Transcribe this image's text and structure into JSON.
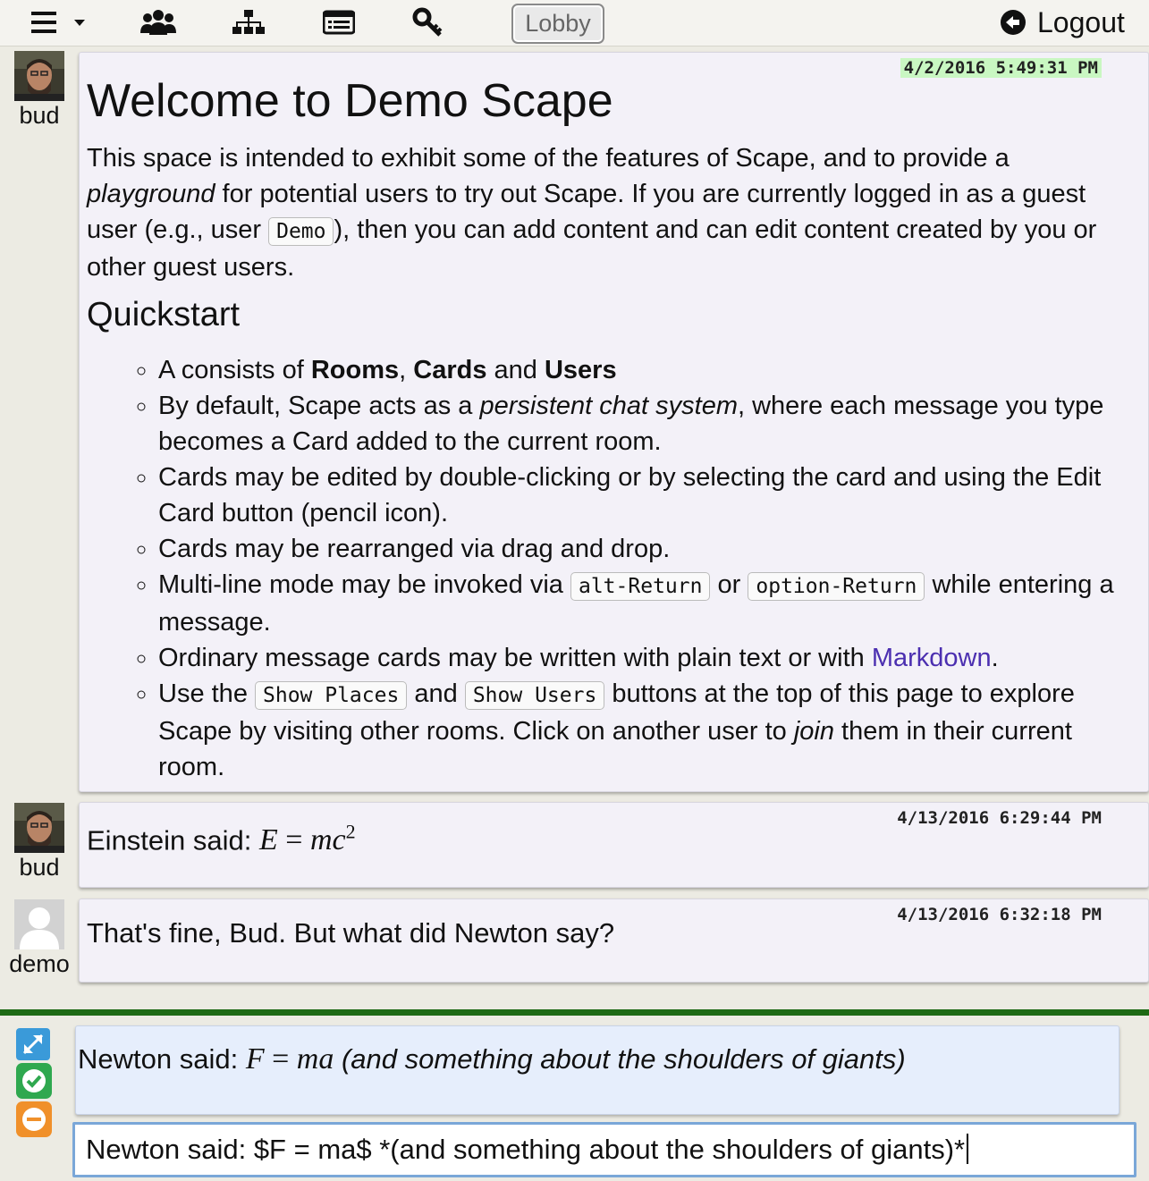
{
  "nav": {
    "lobby_label": "Lobby",
    "logout_label": "Logout",
    "icons": [
      "menu-icon",
      "users-icon",
      "places-icon",
      "cards-list-icon",
      "key-icon",
      "logout-icon"
    ]
  },
  "cards": [
    {
      "user": "bud",
      "timestamp": "4/2/2016 5:49:31 PM",
      "title": "Welcome to Demo Scape",
      "intro": {
        "p1": "This space is intended to exhibit some of the features of Scape, and to provide a ",
        "em": "playground",
        "p2": " for potential users to try out Scape. If you are currently logged in as a guest user (e.g., user ",
        "code": "Demo",
        "p3": "), then you can add content and can edit content created by you or other guest users."
      },
      "subtitle": "Quickstart",
      "items": {
        "i1": {
          "a": "A consists of ",
          "b1": "Rooms",
          "c": ", ",
          "b2": "Cards",
          "d": " and ",
          "b3": "Users"
        },
        "i2": {
          "a": "By default, Scape acts as a ",
          "em": "persistent chat system",
          "b": ", where each message you type becomes a Card added to the current room."
        },
        "i3": "Cards may be edited by double-clicking or by selecting the card and using the Edit Card button (pencil icon).",
        "i4": "Cards may be rearranged via drag and drop.",
        "i5": {
          "a": "Multi-line mode may be invoked via ",
          "k1": "alt-Return",
          "b": " or ",
          "k2": "option-Return",
          "c": " while entering a message."
        },
        "i6": {
          "a": "Ordinary message cards may be written with plain text or with ",
          "link": "Markdown",
          "b": "."
        },
        "i7": {
          "a": "Use the ",
          "k1": "Show Places",
          "b": " and ",
          "k2": "Show Users",
          "c": " buttons at the top of this page to explore Scape by visiting other rooms. Click on another user to ",
          "em": "join",
          "d": " them in their current room."
        }
      }
    },
    {
      "user": "bud",
      "timestamp": "4/13/2016 6:29:44 PM",
      "text": "Einstein said: ",
      "math": {
        "lhs": "E",
        "eq": " = ",
        "rhs": "mc",
        "sup": "2"
      }
    },
    {
      "user": "demo",
      "timestamp": "4/13/2016 6:32:18 PM",
      "text": "That's fine, Bud. But what did Newton say?"
    }
  ],
  "preview": {
    "text": "Newton said: ",
    "math": {
      "lhs": "F",
      "eq": " = ",
      "rhs": "ma"
    },
    "em": " (and something about the shoulders of giants)"
  },
  "input": {
    "value": "Newton said: $F = ma$ *(and something about the shoulders of giants)*"
  },
  "colors": {
    "divider": "#1e6a15",
    "expand": "#3a9ad9",
    "accept": "#2fa84f",
    "cancel": "#f0902a",
    "link": "#4b2fb0"
  }
}
